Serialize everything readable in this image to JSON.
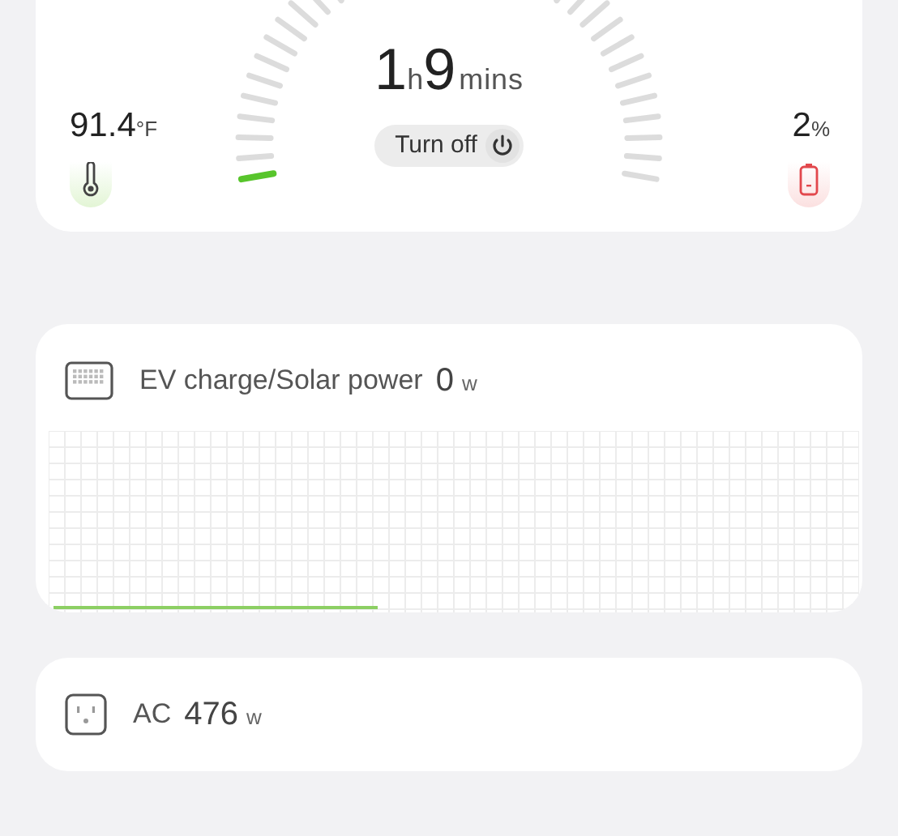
{
  "status_card": {
    "temperature": {
      "value": "91.4",
      "unit": "°F"
    },
    "remaining": {
      "hours": "1",
      "hours_unit": "h",
      "minutes": "9",
      "minutes_unit": "mins"
    },
    "gauge": {
      "level": 0.03
    },
    "turn_off_button": {
      "label": "Turn off"
    },
    "battery": {
      "value": "2",
      "unit": "%"
    }
  },
  "panels": [
    {
      "kind": "solar",
      "label": "EV charge/Solar power",
      "value": "0",
      "unit": "w"
    },
    {
      "kind": "ac",
      "label": "AC",
      "value": "476",
      "unit": "w"
    }
  ]
}
